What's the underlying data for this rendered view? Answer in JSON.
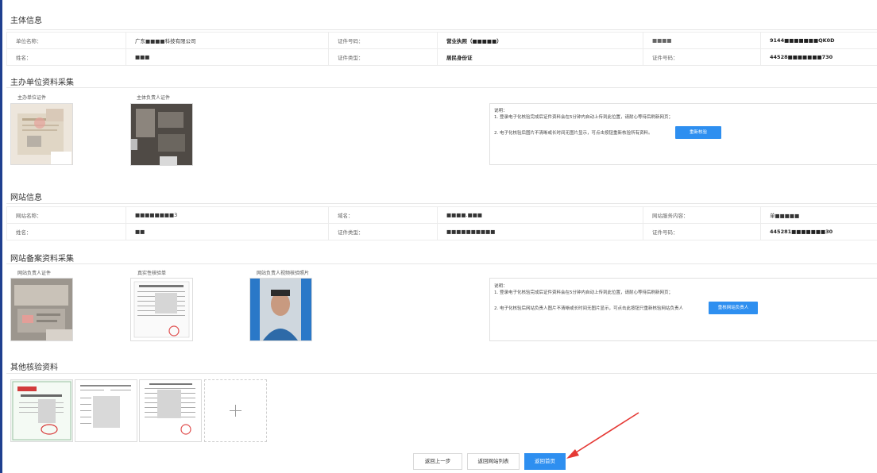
{
  "subject_info": {
    "title": "主体信息",
    "row1": [
      "单位名称：",
      "广东■■■■科技有限公司",
      "证件号码：",
      "营业执照（■■■■■）",
      "■■■■",
      "9144■■■■■■■QK0D"
    ],
    "row2": [
      "姓名：",
      "■■■",
      "证件类型：",
      "居民身份证",
      "证件号码：",
      "44528■■■■■■■730"
    ]
  },
  "host_materials": {
    "title": "主办单位资料采集",
    "captions": [
      "主办单位证件",
      "主体负责人证件"
    ],
    "note_heading": "说明：",
    "note_line1": "1. 登录电子化核验完成后证件资料会在5分钟内自动上传到此位置，请耐心等待后刷新网页；",
    "note_line2": "2. 电子化核验后图片不清晰或长时间无图片显示，可点击按钮重新核验所有资料。",
    "button": "重新核验"
  },
  "website_info": {
    "title": "网站信息",
    "row1": [
      "网站名称：",
      "■■■■■■■■3",
      "域名：",
      "■■■■.■■■",
      "网站服务内容：",
      "单■■■■■"
    ],
    "row2": [
      "姓名：",
      "■■",
      "证件类型：",
      "■■■■■■■■■■",
      "证件号码：",
      "445281■■■■■■■30"
    ]
  },
  "website_materials": {
    "title": "网站备案资料采集",
    "captions": [
      "网站负责人证件",
      "真实性核验单",
      "网站负责人视频核验照片"
    ],
    "note_heading": "说明：",
    "note_line1": "1. 登录电子化核验完成后证件资料会在5分钟内自动上传到此位置，请耐心等待后刷新网页；",
    "note_line2": "2. 电子化核验后网站负责人图片不清晰或长时间无图片显示，可点击此按钮只重新核验网站负责人",
    "button": "重核网站负责人"
  },
  "other_materials": {
    "title": "其他核验资料",
    "add_icon": "plus-icon"
  },
  "footer": {
    "prev": "返回上一步",
    "list": "返回网站列表",
    "home": "返回首页"
  },
  "colors": {
    "accent": "#2e8ff0",
    "annotation_arrow": "#e53935",
    "left_bar": "#1f3f8f"
  }
}
